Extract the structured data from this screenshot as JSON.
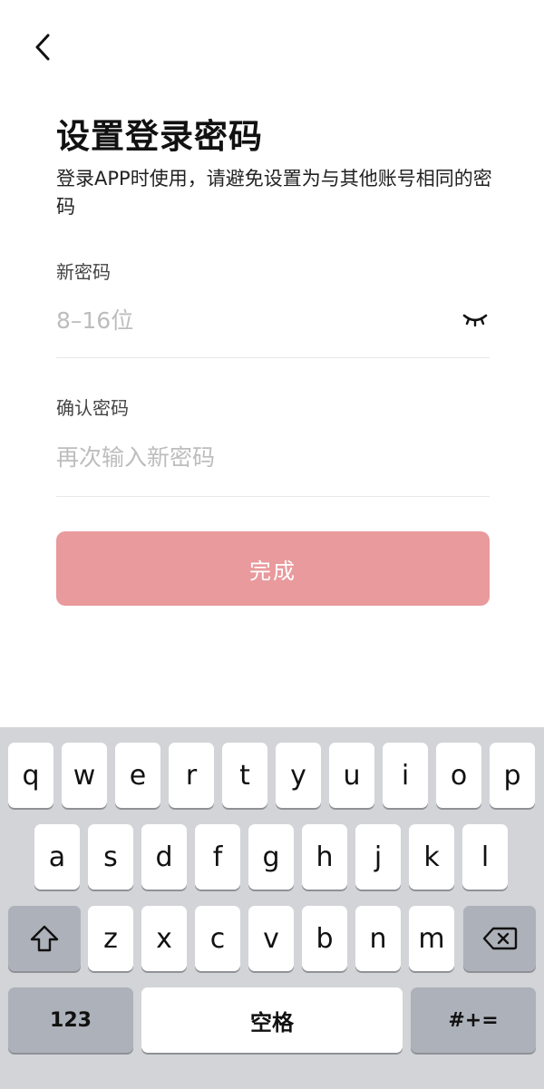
{
  "header": {
    "title": "设置登录密码",
    "subtitle": "登录APP时使用，请避免设置为与其他账号相同的密码"
  },
  "form": {
    "password_label": "新密码",
    "password_placeholder": "8–16位",
    "confirm_label": "确认密码",
    "confirm_placeholder": "再次输入新密码",
    "submit_label": "完成"
  },
  "keyboard": {
    "row1": [
      "q",
      "w",
      "e",
      "r",
      "t",
      "y",
      "u",
      "i",
      "o",
      "p"
    ],
    "row2": [
      "a",
      "s",
      "d",
      "f",
      "g",
      "h",
      "j",
      "k",
      "l"
    ],
    "row3": [
      "z",
      "x",
      "c",
      "v",
      "b",
      "n",
      "m"
    ],
    "numbers_label": "123",
    "space_label": "空格",
    "symbols_label": "#+="
  },
  "icons": {
    "back": "chevron-left-icon",
    "eye": "eye-closed-icon",
    "shift": "shift-arrow-icon",
    "delete": "backspace-icon"
  },
  "colors": {
    "primary_button": "#e99a9c",
    "keyboard_bg": "#d3d4d8",
    "func_key": "#adb1b9",
    "placeholder": "#bdbdbd"
  }
}
